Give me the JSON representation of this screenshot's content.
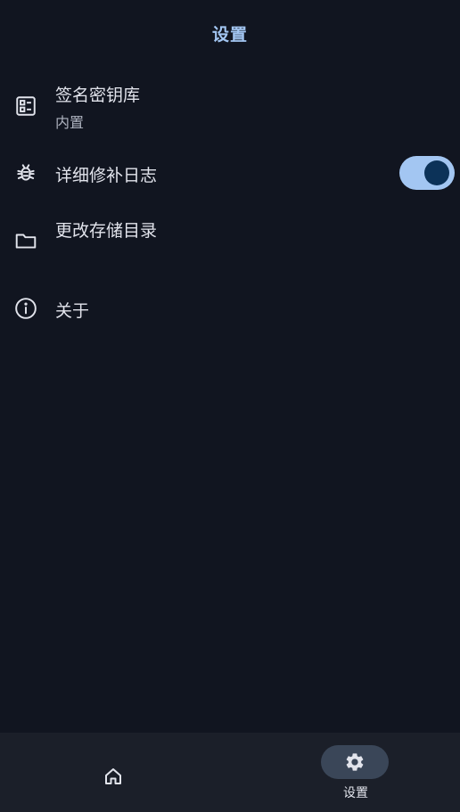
{
  "app_bar": {
    "title": "设置"
  },
  "settings": {
    "items": [
      {
        "title": "签名密钥库",
        "subtitle": "内置",
        "icon": "keystore-icon"
      },
      {
        "title": "详细修补日志",
        "icon": "bug-icon",
        "toggle_on": true
      },
      {
        "title": "更改存储目录",
        "icon": "folder-icon"
      },
      {
        "title": "关于",
        "icon": "info-icon"
      }
    ]
  },
  "bottom_nav": {
    "items": [
      {
        "label": "",
        "icon": "home-icon",
        "selected": false
      },
      {
        "label": "设置",
        "icon": "gear-icon",
        "selected": true
      }
    ]
  },
  "colors": {
    "background": "#111520",
    "accent": "#a3c6f2",
    "toggle_knob": "#0c3258",
    "nav_background": "#1b1f29",
    "nav_selected_pill": "#3a4658"
  }
}
